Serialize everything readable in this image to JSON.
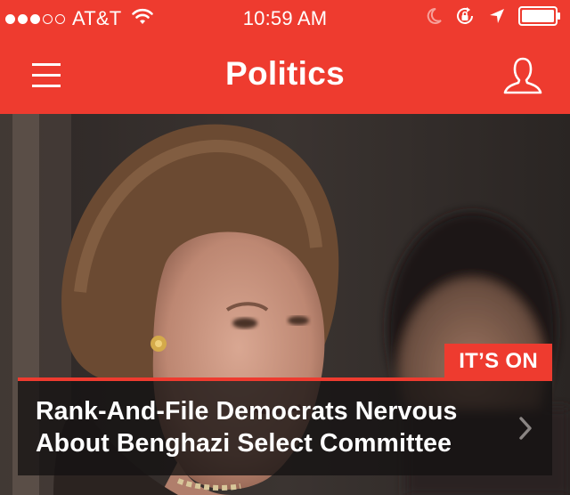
{
  "status_bar": {
    "carrier": "AT&T",
    "time": "10:59 AM",
    "signal_bars_filled": 3,
    "signal_bars_total": 5,
    "icons": [
      "wifi-icon",
      "moon-icon",
      "rotation-lock-icon",
      "location-arrow-icon",
      "battery-icon"
    ]
  },
  "nav": {
    "title": "Politics",
    "menu_icon": "hamburger-menu-icon",
    "profile_icon": "user-profile-icon"
  },
  "story": {
    "badge": "IT’S ON",
    "headline": "Rank-And-File Democrats Nervous About Benghazi Select Committee",
    "chevron_icon": "chevron-right-icon"
  },
  "colors": {
    "brand_red": "#ee3b2f",
    "text": "#ffffff"
  }
}
